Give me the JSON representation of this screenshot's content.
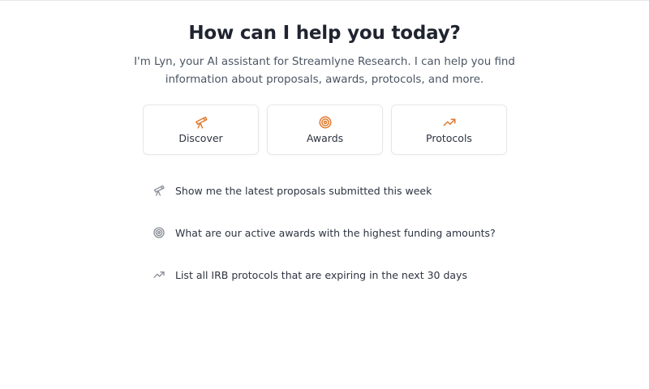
{
  "header": {
    "title": "How can I help you today?",
    "intro": "I'm Lyn, your AI assistant for Streamlyne Research. I can help you find information about proposals, awards, protocols, and more."
  },
  "categories": [
    {
      "label": "Discover",
      "icon": "telescope-icon"
    },
    {
      "label": "Awards",
      "icon": "target-icon"
    },
    {
      "label": "Protocols",
      "icon": "trending-up-icon"
    }
  ],
  "suggestions": [
    {
      "text": "Show me the latest proposals submitted this week",
      "icon": "telescope-icon"
    },
    {
      "text": "What are our active awards with the highest funding amounts?",
      "icon": "target-icon"
    },
    {
      "text": "List all IRB protocols that are expiring in the next 30 days",
      "icon": "trending-up-icon"
    }
  ],
  "colors": {
    "accent": "#e07a2e",
    "muted_icon": "#8a8f98",
    "heading": "#1f2430",
    "body_text": "#4b5563",
    "border": "#e5e7eb"
  }
}
